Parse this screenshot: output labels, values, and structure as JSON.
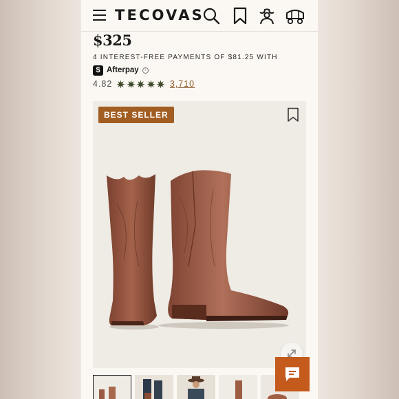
{
  "header": {
    "menu_icon": "hamburger-menu-icon",
    "logo": "TECOVAS",
    "icons": [
      "search-icon",
      "bookmark-icon",
      "account-icon",
      "wagon-cart-icon"
    ]
  },
  "product": {
    "price": "$325",
    "installments_text": "4 INTEREST-FREE PAYMENTS OF $81.25 WITH",
    "afterpay_logo_mark": "$",
    "afterpay_label": "Afterpay",
    "info_icon": "i",
    "rating": "4.82",
    "stars": 5,
    "review_count": "3,710"
  },
  "gallery": {
    "badge": "BEST SELLER",
    "bookmark_icon": "bookmark-icon",
    "expand_icon": "expand-icon",
    "thumbnails": [
      "boots-thumb",
      "model-boots-thumb",
      "model-cowboy-thumb",
      "boots-side-thumb",
      "boots-detail-thumb"
    ],
    "active_thumbnail": 1
  },
  "chat": {
    "icon": "chat-bubble-icon"
  },
  "colors": {
    "page_bg": "#fbf8f3",
    "badge_bg": "#a15d22",
    "star": "#3f4a2c",
    "link": "#8a5a2a",
    "chat_bg": "#c45a1c"
  }
}
